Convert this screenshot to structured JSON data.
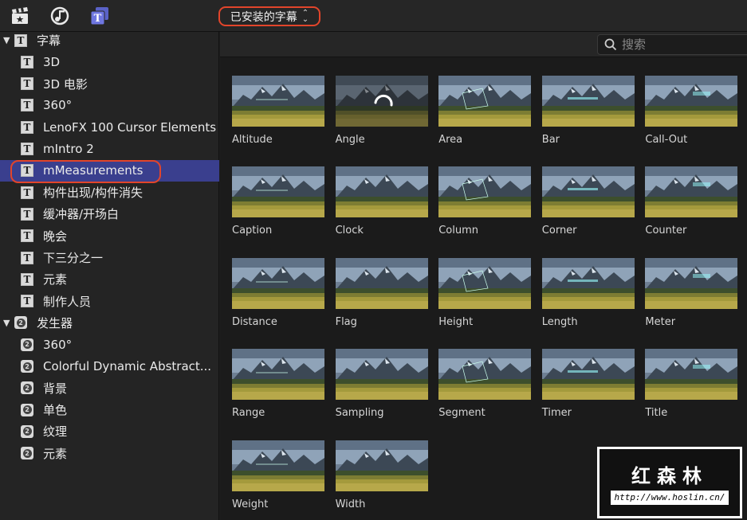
{
  "topbar": {
    "source_select": "已安装的字幕",
    "icons": [
      "clapper-icon",
      "music-photo-icon",
      "titles-icon"
    ]
  },
  "sidebar": {
    "sections": [
      {
        "label": "字幕",
        "type": "titles",
        "expanded": true,
        "items": [
          "3D",
          "3D 电影",
          "360°",
          "LenoFX 100 Cursor Elements",
          "mIntro 2",
          "mMeasurements",
          "构件出现/构件消失",
          "缓冲器/开场白",
          "晚会",
          "下三分之一",
          "元素",
          "制作人员"
        ]
      },
      {
        "label": "发生器",
        "type": "generators",
        "expanded": true,
        "items": [
          "360°",
          "Colorful Dynamic Abstract...",
          "背景",
          "单色",
          "纹理",
          "元素"
        ]
      }
    ],
    "selected_item": "mMeasurements"
  },
  "search": {
    "placeholder": "搜索"
  },
  "grid": {
    "items": [
      "Altitude",
      "Angle",
      "Area",
      "Bar",
      "Call-Out",
      "Caption",
      "Clock",
      "Column",
      "Corner",
      "Counter",
      "Distance",
      "Flag",
      "Height",
      "Length",
      "Meter",
      "Range",
      "Sampling",
      "Segment",
      "Timer",
      "Title",
      "Weight",
      "Width"
    ],
    "loading_item": "Angle"
  },
  "watermark": {
    "title": "红森林",
    "url": "http://www.hoslin.cn/"
  },
  "colors": {
    "accent_highlight": "#e2452b",
    "selection": "#3a3f8e"
  }
}
